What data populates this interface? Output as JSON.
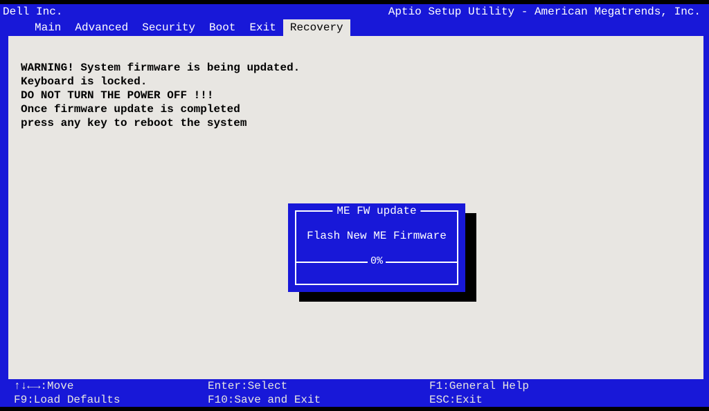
{
  "header": {
    "vendor": "Dell Inc.",
    "utility": "Aptio Setup Utility - American Megatrends, Inc."
  },
  "tabs": {
    "main": "Main",
    "advanced": "Advanced",
    "security": "Security",
    "boot": "Boot",
    "exit": "Exit",
    "recovery": "Recovery",
    "active": "recovery"
  },
  "warning": {
    "line1": "WARNING! System firmware is being updated.",
    "line2": "Keyboard is locked.",
    "line3": "DO NOT TURN THE POWER OFF !!!",
    "line4": "Once firmware update is completed",
    "line5": "press any key to reboot the system"
  },
  "dialog": {
    "title": "ME FW update",
    "message": "Flash New ME Firmware",
    "progress_percent": 0,
    "progress_label": "0%"
  },
  "footer": {
    "move": "↑↓←→:Move",
    "select": "Enter:Select",
    "help": "F1:General Help",
    "defaults": "F9:Load Defaults",
    "save": "F10:Save and Exit",
    "exit": "ESC:Exit"
  }
}
